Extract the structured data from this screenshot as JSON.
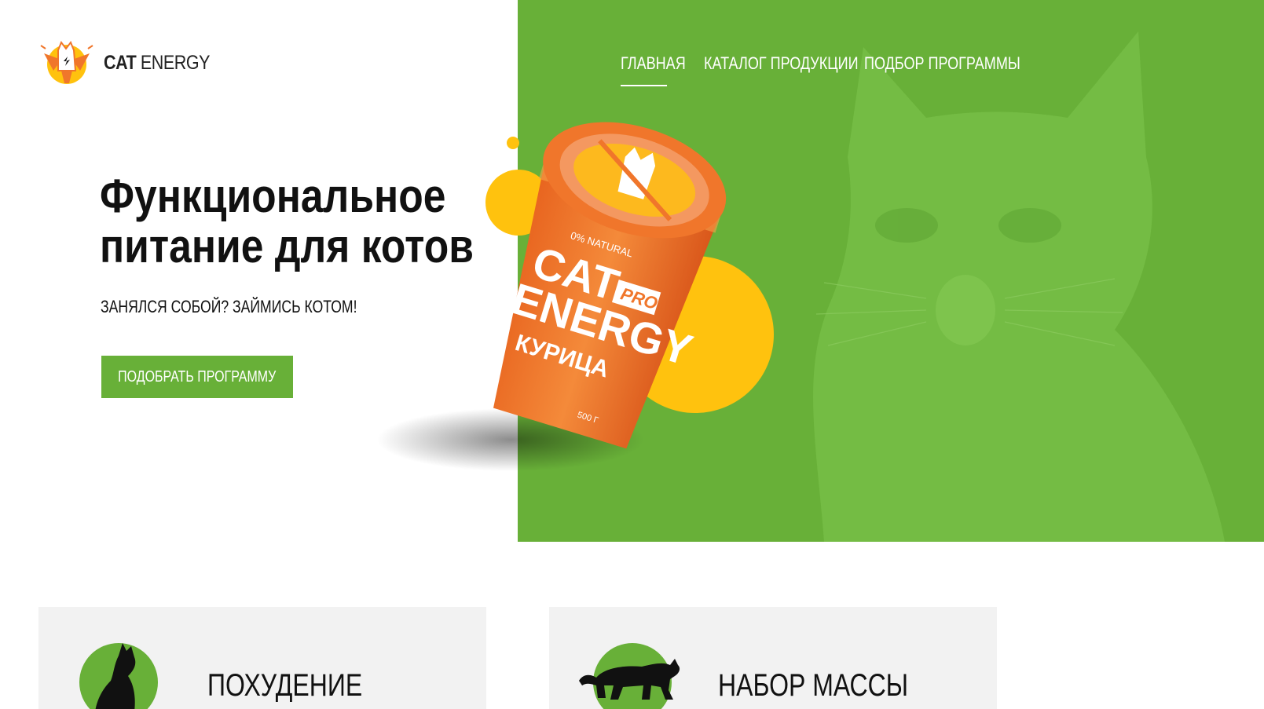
{
  "brand": {
    "name_bold": "CAT",
    "name_regular": "ENERGY"
  },
  "nav": [
    {
      "label": "ГЛАВНАЯ",
      "active": true
    },
    {
      "label": "КАТАЛОГ ПРОДУКЦИИ",
      "active": false
    },
    {
      "label": "ПОДБОР ПРОГРАММЫ",
      "active": false
    }
  ],
  "hero": {
    "title_line1": "Функциональное",
    "title_line2": "питание для котов",
    "subtitle": "ЗАНЯЛСЯ СОБОЙ? ЗАЙМИСЬ КОТОМ!",
    "cta_label": "ПОДОБРАТЬ ПРОГРАММУ"
  },
  "product": {
    "badge": "0% NATURAL",
    "brand_line1": "CAT",
    "brand_line2": "ENERGY",
    "pro": "PRO",
    "flavor": "КУРИЦА",
    "weight": "500 Г"
  },
  "cards": [
    {
      "title": "ПОХУДЕНИЕ",
      "icon": "slim-cat-icon"
    },
    {
      "title": "НАБОР МАССЫ",
      "icon": "big-cat-icon"
    }
  ],
  "colors": {
    "green": "#68b038",
    "yellow": "#ffc20e",
    "orange": "#f0762b",
    "card_bg": "#f2f2f2"
  }
}
